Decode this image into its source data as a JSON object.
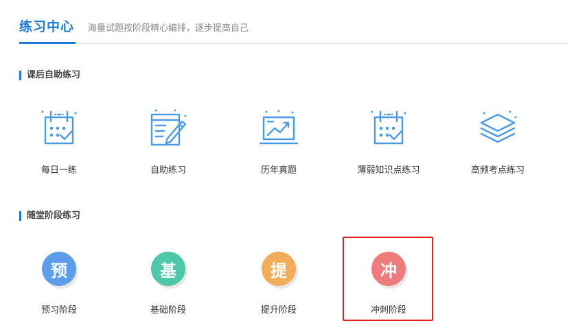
{
  "header": {
    "title": "练习中心",
    "subtitle": "海量试题按阶段精心编排，逐步提高自己",
    "accent_color": "#1f7ad6"
  },
  "sections": [
    {
      "title": "课后自助练习",
      "items": [
        {
          "label": "每日一练",
          "icon": "calendar-check-icon"
        },
        {
          "label": "自助练习",
          "icon": "notebook-pen-icon"
        },
        {
          "label": "历年真题",
          "icon": "laptop-chart-icon"
        },
        {
          "label": "薄弱知识点练习",
          "icon": "calendar-check-icon"
        },
        {
          "label": "高频考点练习",
          "icon": "layers-stack-icon"
        }
      ]
    },
    {
      "title": "随堂阶段练习",
      "items": [
        {
          "label": "预习阶段",
          "badge": "预",
          "color": "#5b9de8"
        },
        {
          "label": "基础阶段",
          "badge": "基",
          "color": "#4fc8a8"
        },
        {
          "label": "提升阶段",
          "badge": "提",
          "color": "#f2ad5a"
        },
        {
          "label": "冲刺阶段",
          "badge": "冲",
          "color": "#ee7c7c"
        }
      ]
    }
  ]
}
